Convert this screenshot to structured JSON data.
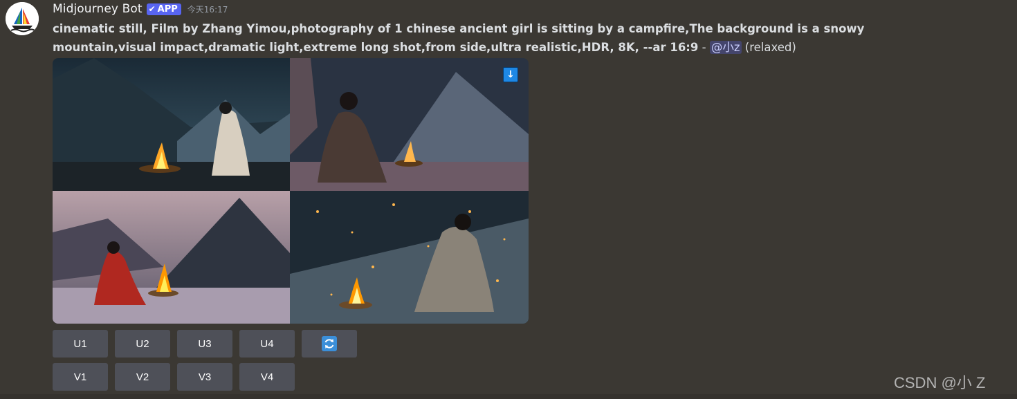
{
  "message": {
    "username": "Midjourney Bot",
    "app_tag": "APP",
    "timestamp": "今天16:17",
    "prompt": "cinematic still, Film by Zhang Yimou,photography of 1 chinese ancient girl is sitting by a campfire,The background is a snowy mountain,visual impact,dramatic light,extreme long shot,from side,ultra realistic,HDR, 8K, --ar 16:9",
    "separator": " - ",
    "mention": "@小z",
    "mode": " (relaxed)"
  },
  "image_grid": {
    "tiles": [
      "tile-1",
      "tile-2",
      "tile-3",
      "tile-4"
    ]
  },
  "buttons": {
    "upscale": [
      "U1",
      "U2",
      "U3",
      "U4"
    ],
    "variation": [
      "V1",
      "V2",
      "V3",
      "V4"
    ],
    "reroll_icon": "refresh-icon"
  },
  "watermark": "CSDN @小 Z",
  "colors": {
    "background": "#3b3833",
    "button": "#4e5058",
    "app_tag": "#5865f2",
    "mention": "#c9cdfb"
  }
}
